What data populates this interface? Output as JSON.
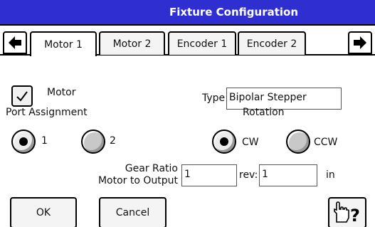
{
  "title": "Fixture Configuration",
  "tabs": [
    {
      "label": "Motor 1",
      "active": true
    },
    {
      "label": "Motor 2",
      "active": false
    },
    {
      "label": "Encoder 1",
      "active": false
    },
    {
      "label": "Encoder 2",
      "active": false
    }
  ],
  "motor": {
    "checkbox_label": "Motor",
    "checked": true,
    "type_label": "Type",
    "type_value": "Bipolar Stepper"
  },
  "port": {
    "heading": "Port Assignment",
    "options": [
      "1",
      "2"
    ],
    "selected": "1"
  },
  "rotation": {
    "heading": "Rotation",
    "options": [
      "CW",
      "CCW"
    ],
    "selected": "CW"
  },
  "gear": {
    "label_line1": "Gear Ratio",
    "label_line2": "Motor to Output",
    "value": "1",
    "rev_label": "rev:",
    "rev_value": "1",
    "unit": "in"
  },
  "buttons": {
    "ok": "OK",
    "cancel": "Cancel"
  },
  "icons": {
    "left_arrow": "left-arrow-icon",
    "right_arrow": "right-arrow-icon",
    "help": "pointing-hand-question-icon"
  },
  "colors": {
    "titlebar": "#2f2fd1",
    "title_text": "#ffffff"
  }
}
